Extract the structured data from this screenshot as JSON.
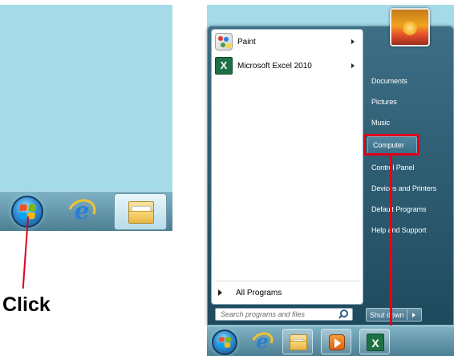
{
  "left_panel": {
    "annotation": "Click"
  },
  "start_menu": {
    "pinned_programs": [
      {
        "label": "Paint",
        "icon": "paint-icon",
        "has_submenu": true
      },
      {
        "label": "Microsoft Excel 2010",
        "icon": "excel-icon",
        "has_submenu": true
      }
    ],
    "all_programs_label": "All Programs",
    "search_placeholder": "Search programs and files",
    "right_items": [
      {
        "label": "Documents"
      },
      {
        "label": "Pictures"
      },
      {
        "label": "Music"
      },
      {
        "label": "Computer",
        "highlighted": true
      },
      {
        "label": "Control Panel"
      },
      {
        "label": "Devices and Printers"
      },
      {
        "label": "Default Programs"
      },
      {
        "label": "Help and Support"
      }
    ],
    "shutdown_label": "Shut down"
  },
  "colors": {
    "desktop": "#a5dbe9",
    "annotation_red": "#e0001b",
    "start_menu_bg": "#2f5e74"
  }
}
